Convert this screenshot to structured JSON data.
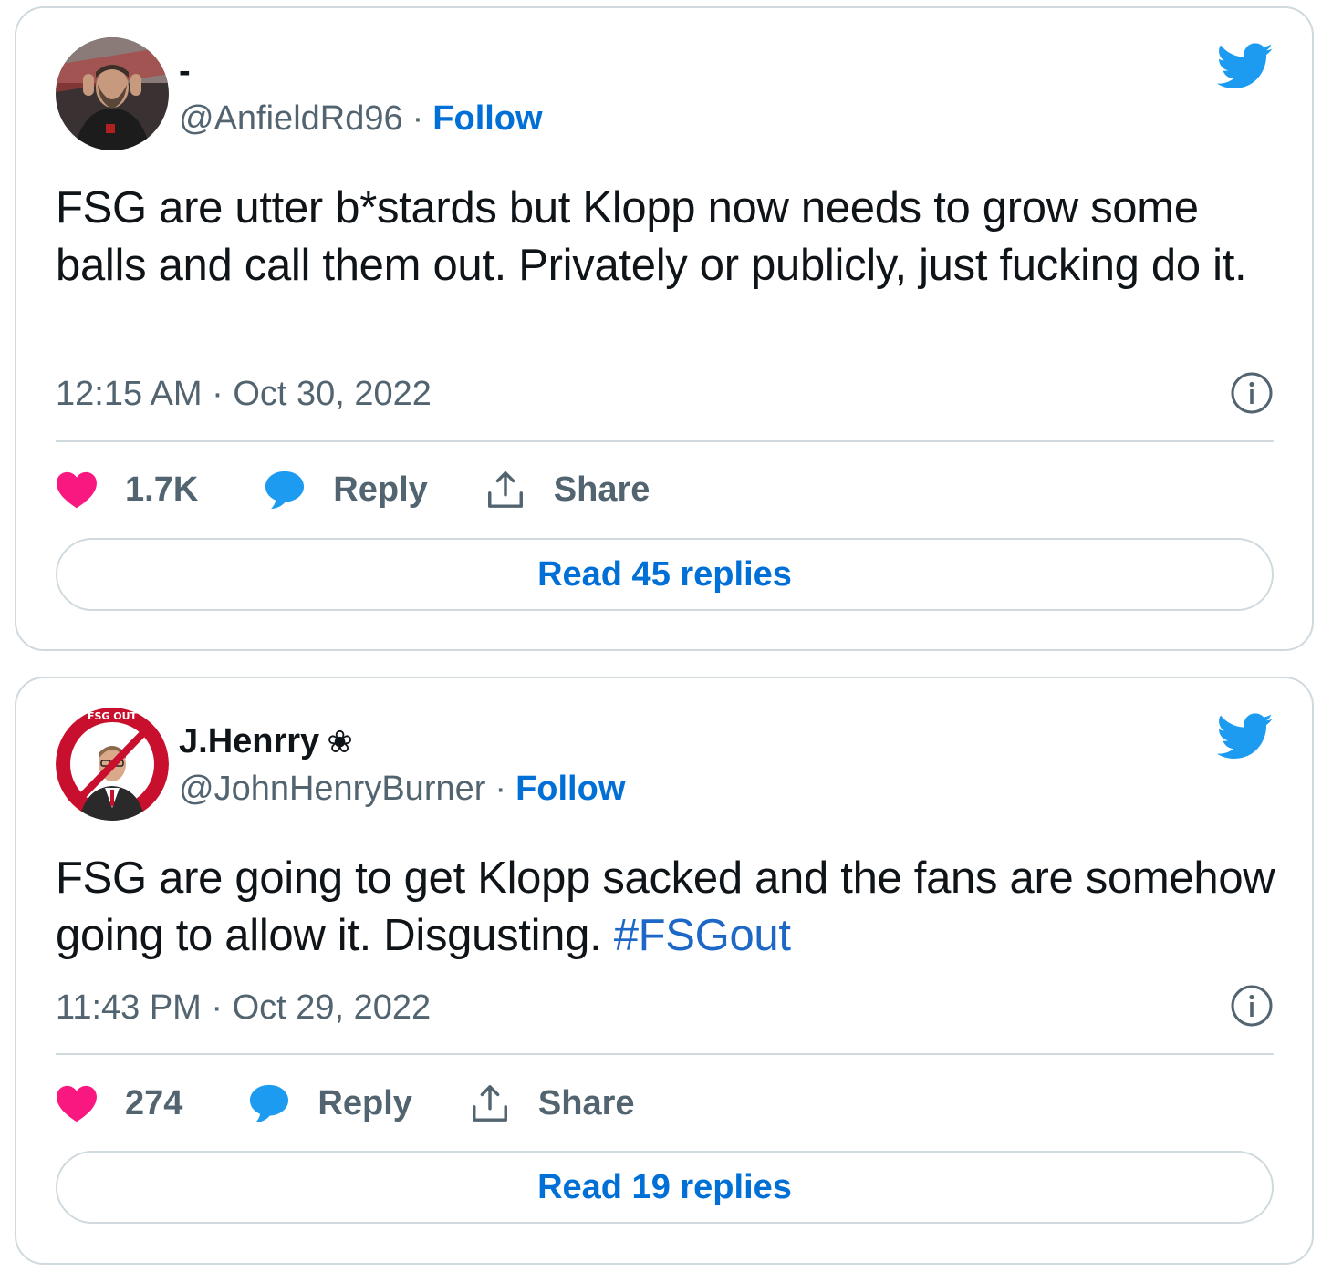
{
  "tweets": [
    {
      "display_name": "-",
      "name_badge": "",
      "handle": "@AnfieldRd96",
      "separator": "·",
      "follow_label": "Follow",
      "text": "FSG are utter b*stards but Klopp now needs to grow some balls and call them out. Privately or publicly, just fucking do it.",
      "hashtag": "",
      "timestamp": "12:15 AM · Oct 30, 2022",
      "likes": "1.7K",
      "reply_label": "Reply",
      "share_label": "Share",
      "read_replies_label": "Read 45 replies"
    },
    {
      "display_name": "J.Henrry",
      "name_badge": "❀",
      "handle": "@JohnHenryBurner",
      "separator": "·",
      "follow_label": "Follow",
      "text": "FSG are going to get Klopp sacked and the fans are somehow going to allow it. Disgusting. ",
      "hashtag": "#FSGout",
      "timestamp": "11:43 PM · Oct 29, 2022",
      "likes": "274",
      "reply_label": "Reply",
      "share_label": "Share",
      "read_replies_label": "Read 19 replies"
    }
  ],
  "avatar2_ring_text": "FSG OUT",
  "colors": {
    "twitter_blue": "#1d9bf0",
    "link_blue": "#006fd6",
    "heart_pink": "#f91880",
    "text_gray": "#536471",
    "border": "#cfd9de"
  },
  "icons": [
    "twitter-bird-icon",
    "info-icon",
    "heart-icon",
    "reply-bubble-icon",
    "share-upload-icon"
  ]
}
